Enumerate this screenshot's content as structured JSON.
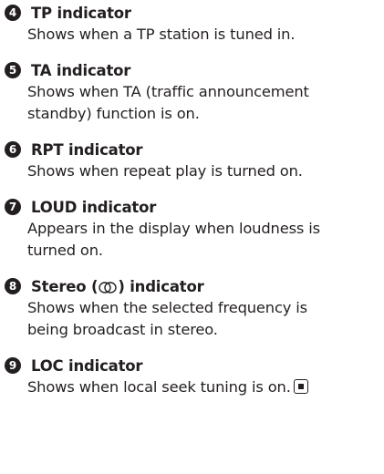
{
  "entries": [
    {
      "number": "4",
      "title": "TP indicator",
      "description": "Shows when a TP station is tuned in."
    },
    {
      "number": "5",
      "title": "TA indicator",
      "description_lines": [
        "Shows when TA (traffic announcement",
        "standby) function is on."
      ]
    },
    {
      "number": "6",
      "title": "RPT indicator",
      "description": "Shows when repeat play is turned on."
    },
    {
      "number": "7",
      "title": "LOUD indicator",
      "description_lines": [
        "Appears in the display when loudness is",
        "turned on."
      ]
    },
    {
      "number": "8",
      "title_before": "Stereo (",
      "title_symbol": "stereo-icon",
      "title_after": ") indicator",
      "description_lines": [
        "Shows when the selected frequency is",
        "being broadcast in stereo."
      ]
    },
    {
      "number": "9",
      "title": "LOC indicator",
      "description": "Shows when local seek tuning is on.",
      "end_mark": "end-of-section-icon"
    }
  ]
}
